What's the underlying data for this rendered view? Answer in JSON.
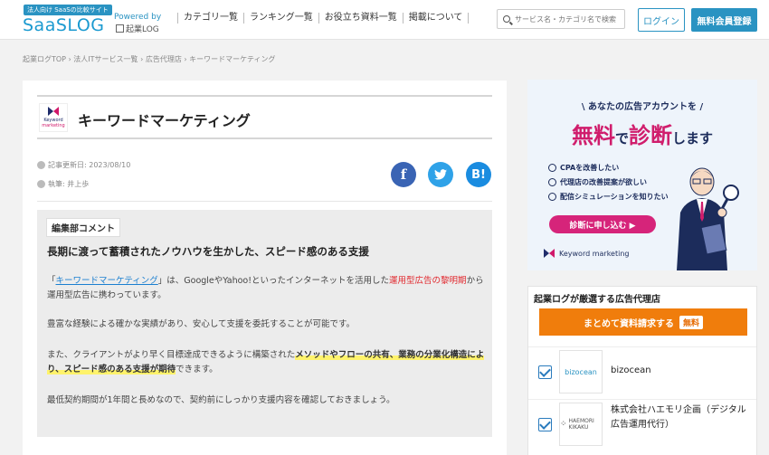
{
  "header": {
    "logo_tag": "法人向け SaaSの比較サイト",
    "logo_main": "SaaSLOG",
    "logo_powered": "Powered by",
    "logo_kigyo": "起業LOG",
    "nav": [
      "カテゴリ一覧",
      "ランキング一覧",
      "お役立ち資料一覧",
      "掲載について"
    ],
    "search_placeholder": "サービス名・カテゴリ名で検索",
    "login": "ログイン",
    "signup": "無料会員登録"
  },
  "breadcrumb": "起業ログTOP › 法人ITサービス一覧 › 広告代理店 › キーワードマーケティング",
  "page": {
    "title": "キーワードマーケティング",
    "logo_line1": "Keyword",
    "logo_line2": "marketing",
    "updated": "記事更新日: 2023/08/10",
    "author": "執筆: 井上歩"
  },
  "social": {
    "facebook": "f",
    "twitter": "t",
    "hatena": "B!"
  },
  "comment": {
    "label": "編集部コメント",
    "heading": "長期に渡って蓄積されたノウハウを生かした、スピード感のある支援",
    "p1_pre": "「",
    "p1_link": "キーワードマーケティング",
    "p1_mid": "」は、GoogleやYahoo!といったインターネットを活用した",
    "p1_red": "運用型広告の黎明期",
    "p1_post": "から運用型広告に携わっています。",
    "p2": "豊富な経験による確かな実績があり、安心して支援を委託することが可能です。",
    "p3_pre": "また、クライアントがより早く目標達成できるように構築された",
    "p3_hl": "メソッドやフローの共有、業務の分業化構造により、スピード感のある支援が期待",
    "p3_post": "できます。",
    "p4": "最低契約期間が1年間と長めなので、契約前にしっかり支援内容を確認しておきましょう。"
  },
  "ad": {
    "sub": "\\ あなたの広告アカウントを /",
    "main_a": "無料",
    "main_b": "で",
    "main_c": "診断",
    "main_d": "します",
    "items": [
      "CPAを改善したい",
      "代理店の改善提案が欲しい",
      "配信シミュレーションを知りたい"
    ],
    "button": "診断に申し込む ▶",
    "brand": "Keyword marketing"
  },
  "agency": {
    "title": "起業ログが厳選する広告代理店",
    "button": "まとめて資料請求する",
    "badge": "無料",
    "items": [
      {
        "name": "bizocean",
        "thumb": "bizocean"
      },
      {
        "name": "株式会社ハエモリ企画（デジタル広告運用代行）",
        "thumb": "HAEMORI KIKAKU"
      }
    ]
  },
  "colors": {
    "brand": "#2a93c2",
    "accent_orange": "#f07d0c",
    "pink": "#d01d6c",
    "navy": "#1c2c5b"
  }
}
